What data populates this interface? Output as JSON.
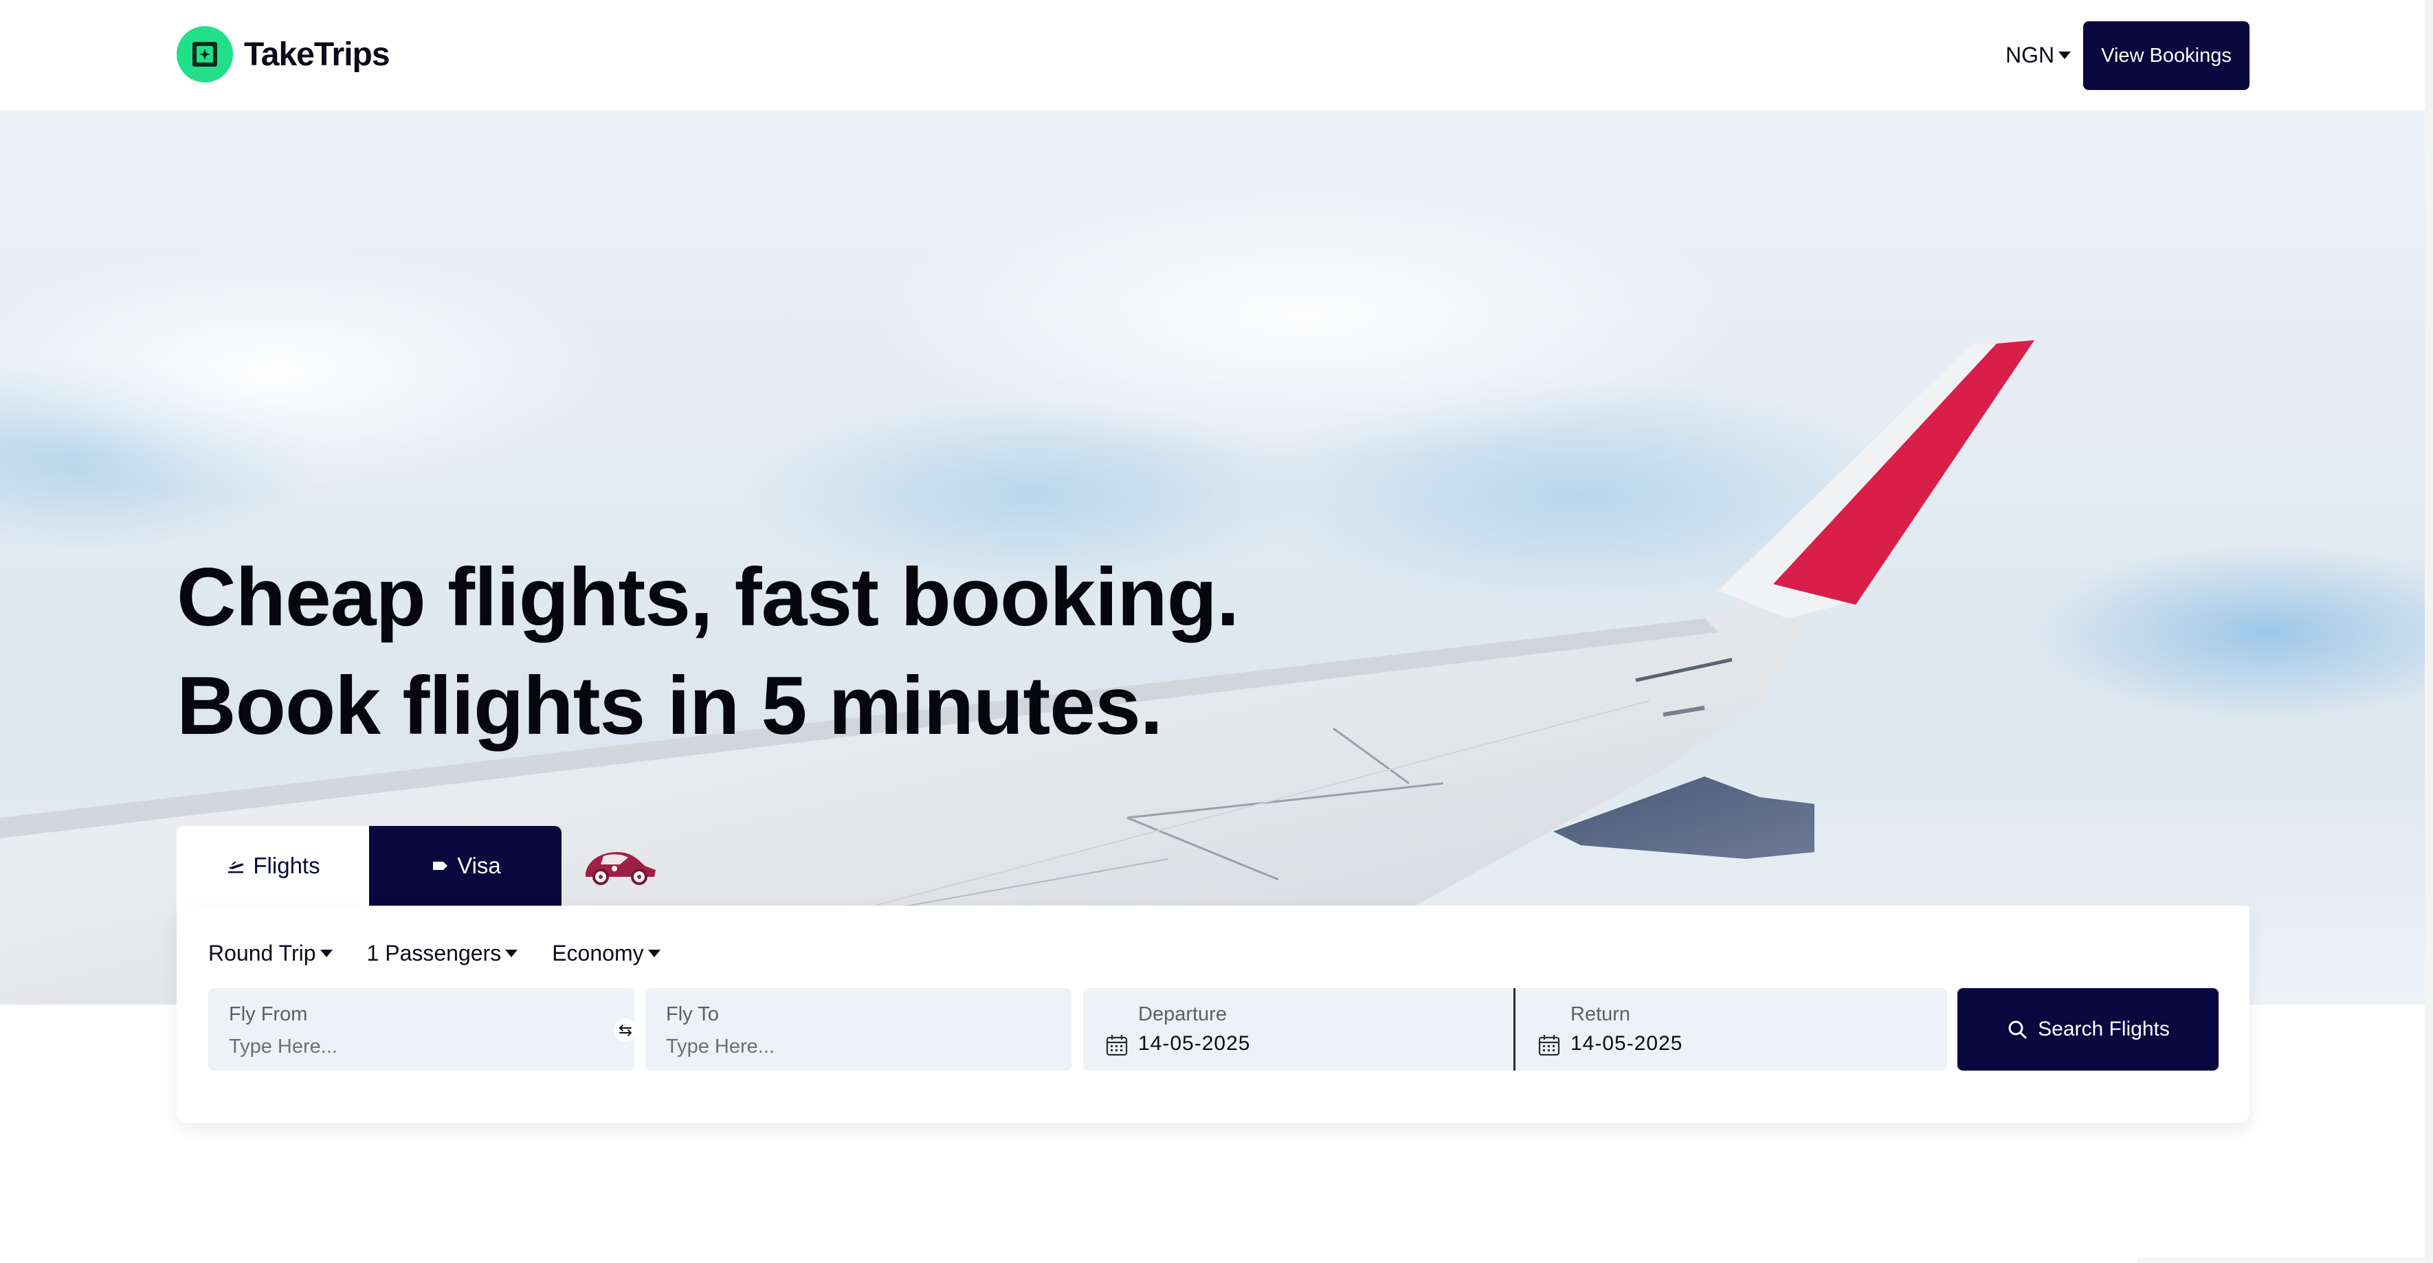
{
  "brand": {
    "name": "TakeTrips",
    "accent": "#22e08a",
    "navy": "#08073e"
  },
  "header": {
    "currency": "NGN",
    "view_bookings": "View Bookings"
  },
  "hero": {
    "line1": "Cheap flights, fast booking.",
    "line2": "Book flights in 5 minutes.",
    "wing_color": "#d91e4a"
  },
  "tabs": [
    {
      "label": "Flights",
      "icon": "plane-icon",
      "active": true
    },
    {
      "label": "Visa",
      "icon": "tag-icon",
      "active": false
    }
  ],
  "search": {
    "trip_type": "Round Trip",
    "passengers": "1 Passengers",
    "cabin": "Economy",
    "from": {
      "label": "Fly From",
      "placeholder": "Type Here...",
      "value": ""
    },
    "to": {
      "label": "Fly To",
      "placeholder": "Type Here...",
      "value": ""
    },
    "departure": {
      "label": "Departure",
      "value": "14-05-2025"
    },
    "return": {
      "label": "Return",
      "value": "14-05-2025"
    },
    "submit": "Search Flights"
  }
}
